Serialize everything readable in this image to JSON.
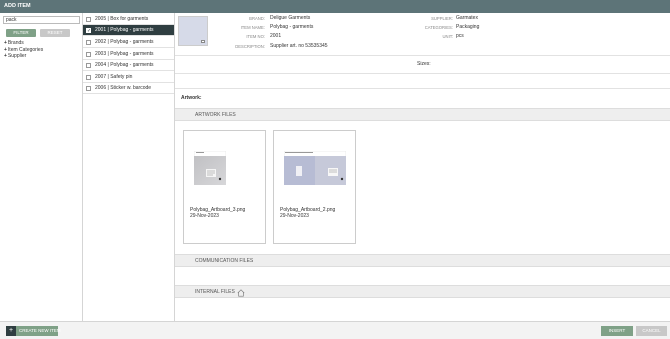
{
  "window": {
    "title": "ADD ITEM"
  },
  "filter": {
    "search_value": "pack",
    "filter_label": "FILTER",
    "reset_label": "RESET",
    "tree": [
      "Brands",
      "Item Categories",
      "Supplier"
    ]
  },
  "items": [
    {
      "label": "2005 | Box for garments",
      "checked": false
    },
    {
      "label": "2001 | Polybag - garments",
      "checked": true
    },
    {
      "label": "2002 | Polybag - garments",
      "checked": false
    },
    {
      "label": "2003 | Polybag - garments",
      "checked": false
    },
    {
      "label": "2004 | Polybag - garments",
      "checked": false
    },
    {
      "label": "2007 | Safety pin",
      "checked": false
    },
    {
      "label": "2006 | Sticker w. barcode",
      "checked": false
    }
  ],
  "details": {
    "brand_label": "BRAND:",
    "brand": "Deligue Garments",
    "item_name_label": "ITEM NAME:",
    "item_name": "Polybag - garments",
    "item_no_label": "ITEM NO:",
    "item_no": "2001",
    "description_label": "DESCRIPTION:",
    "description": "Supplier art. no 53535345",
    "supplier_label": "SUPPLIER:",
    "supplier": "Garmatex",
    "category_label": "CATEGORIES:",
    "category": "Packaging",
    "unit_label": "UNIT:",
    "unit": "pcs"
  },
  "sizes_label": "Sizes:",
  "artwork_label": "Artwork:",
  "sections": {
    "artwork_files": "ARTWORK FILES",
    "communication_files": "COMMUNICATION FILES",
    "internal_files": "INTERNAL FILES"
  },
  "files": [
    {
      "name": "Polybag_Artboard_3.png",
      "date": "29-Nov-2023"
    },
    {
      "name": "Polybag_Artboard_2.png",
      "date": "29-Nov-2023"
    }
  ],
  "footer": {
    "create_label": "CREATE NEW ITEM",
    "insert_label": "INSERT",
    "cancel_label": "CANCEL"
  },
  "colors": {
    "titlebar": "#5d7478",
    "accent_green": "#7fa187",
    "selected_row": "#2f3e41"
  }
}
